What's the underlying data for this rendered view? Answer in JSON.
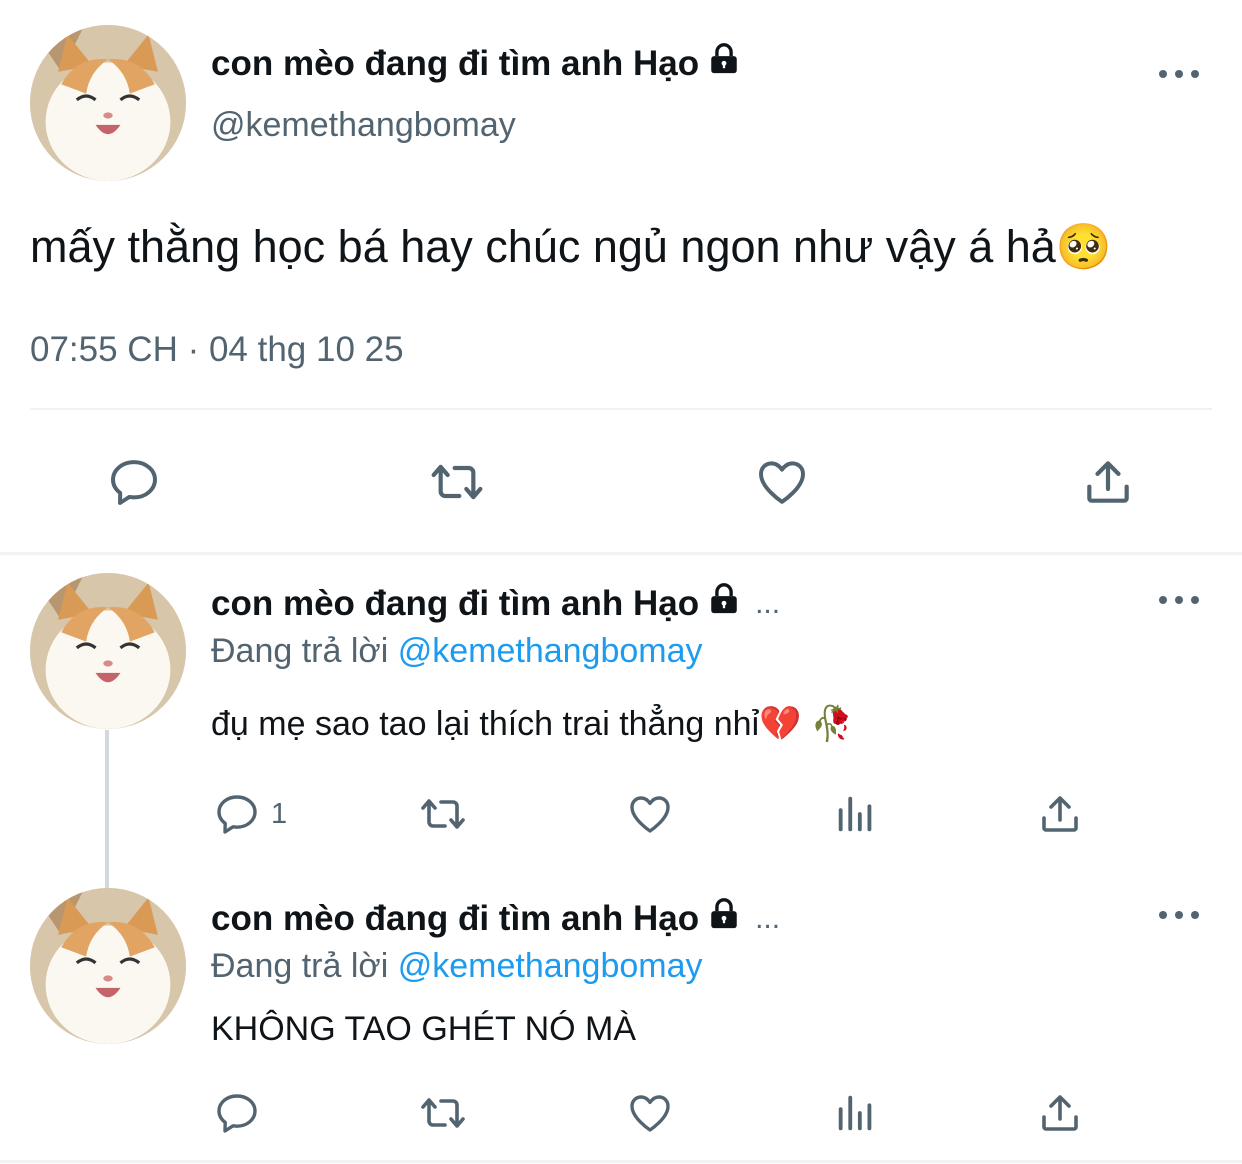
{
  "main_tweet": {
    "display_name": "con mèo đang đi tìm anh Hạo",
    "handle": "@kemethangbomay",
    "text": "mấy thằng học bá hay chúc ngủ ngon như vậy á hả🥺",
    "timestamp": "07:55 CH · 04 thg 10 25"
  },
  "replies": [
    {
      "display_name": "con mèo đang đi tìm anh Hạo",
      "ellipsis": "...",
      "replying_prefix": "Đang trả lời",
      "replying_handle": "@kemethangbomay",
      "text": "đụ mẹ sao tao lại thích trai thẳng nhỉ💔 🥀",
      "reply_count": "1"
    },
    {
      "display_name": "con mèo đang đi tìm anh Hạo",
      "ellipsis": "...",
      "replying_prefix": "Đang trả lời",
      "replying_handle": "@kemethangbomay",
      "text": "KHÔNG TAO GHÉT NÓ MÀ",
      "reply_count": ""
    }
  ],
  "icons": {
    "reply": "comment-icon",
    "retweet": "retweet-icon",
    "like": "heart-icon",
    "views": "analytics-icon",
    "share": "share-icon",
    "lock": "lock-icon",
    "more": "more-icon"
  },
  "colors": {
    "text": "#0f1419",
    "secondary": "#536471",
    "accent": "#1d9bf0",
    "divider": "#eff3f4"
  }
}
